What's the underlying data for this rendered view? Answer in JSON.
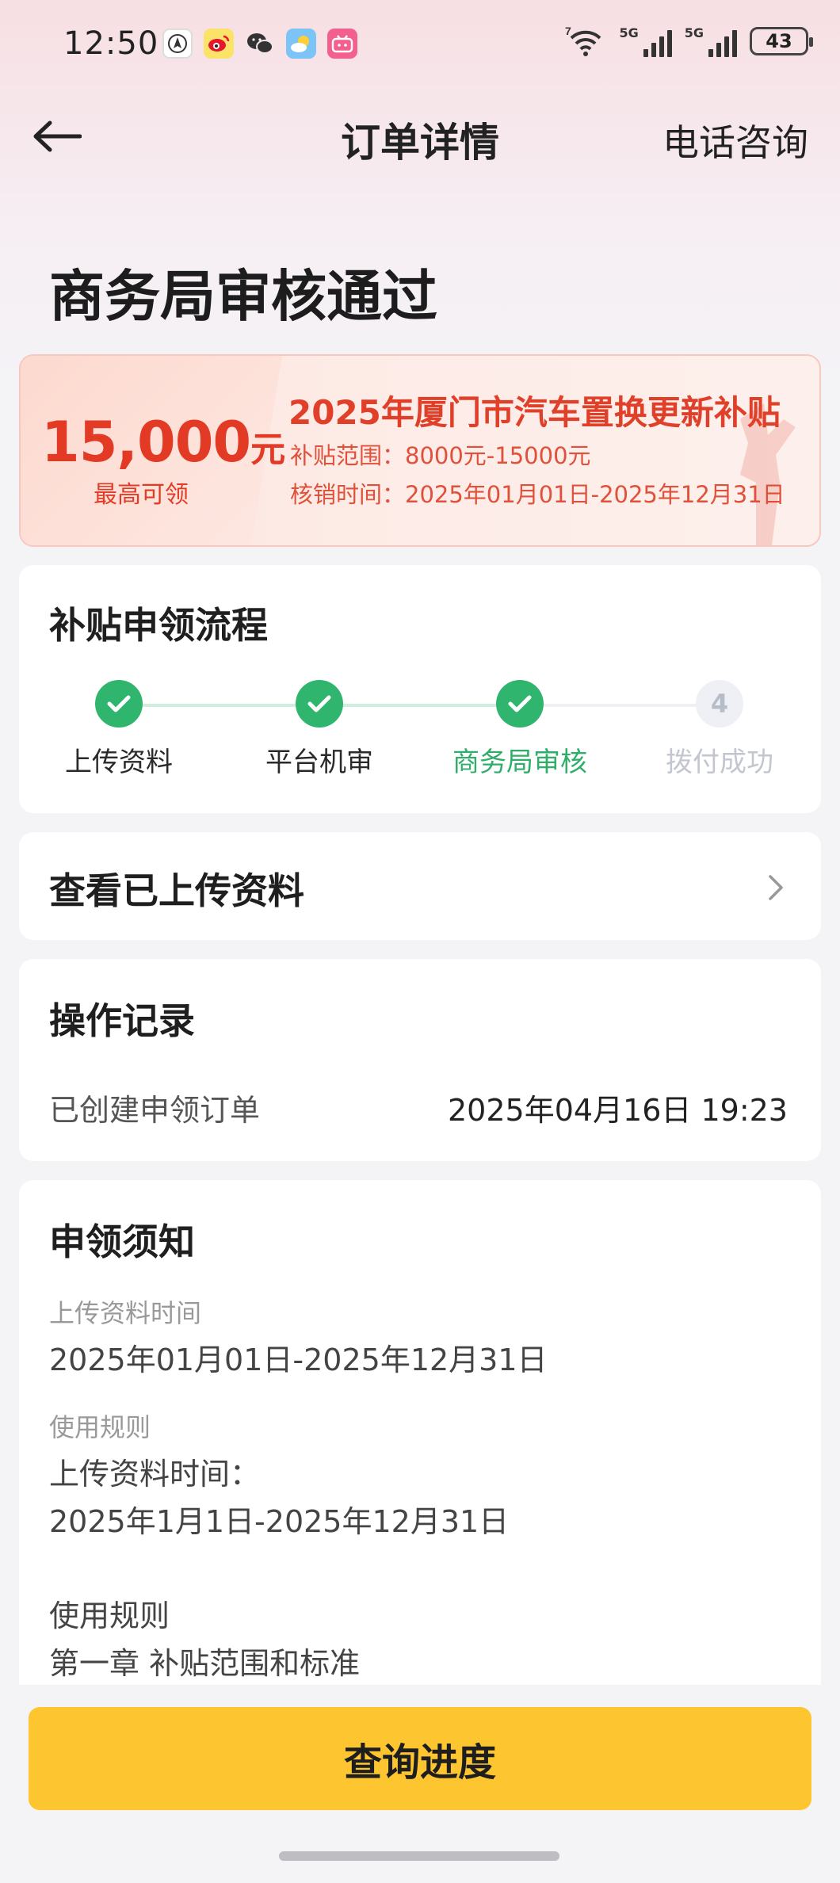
{
  "status_bar": {
    "time": "12:50",
    "notification_icons": [
      "maps-icon",
      "weibo-icon",
      "wechat-icon",
      "weather-icon",
      "bilibili-icon"
    ],
    "wifi_label": "7",
    "signal_1_label": "5G",
    "signal_2_label": "5G",
    "battery": "43"
  },
  "header": {
    "title": "订单详情",
    "action": "电话咨询"
  },
  "status_title": "商务局审核通过",
  "banner": {
    "amount": "15,000",
    "amount_unit": "元",
    "amount_caption": "最高可领",
    "title": "2025年厦门市汽车置换更新补贴",
    "range": "补贴范围：8000元-15000元",
    "period": "核销时间：2025年01月01日-2025年12月31日"
  },
  "process": {
    "title": "补贴申领流程",
    "steps": [
      {
        "label": "上传资料",
        "state": "done"
      },
      {
        "label": "平台机审",
        "state": "done"
      },
      {
        "label": "商务局审核",
        "state": "current"
      },
      {
        "label": "拨付成功",
        "state": "pending",
        "number": "4"
      }
    ]
  },
  "uploaded": {
    "title": "查看已上传资料"
  },
  "log": {
    "title": "操作记录",
    "entries": [
      {
        "action": "已创建申领订单",
        "time": "2025年04月16日 19:23"
      }
    ]
  },
  "notice": {
    "title": "申领须知",
    "upload_time_label": "上传资料时间",
    "upload_time_value": "2025年01月01日-2025年12月31日",
    "rules_label": "使用规则",
    "rules_line1": "上传资料时间：",
    "rules_line2": "2025年1月1日-2025年12月31日",
    "rules_line3": "使用规则",
    "rules_line4": "第一章 补贴范围和标准"
  },
  "footer": {
    "button": "查询进度"
  },
  "colors": {
    "accent_yellow": "#fdc630",
    "success_green": "#2fb56e",
    "banner_red": "#e33a25"
  }
}
